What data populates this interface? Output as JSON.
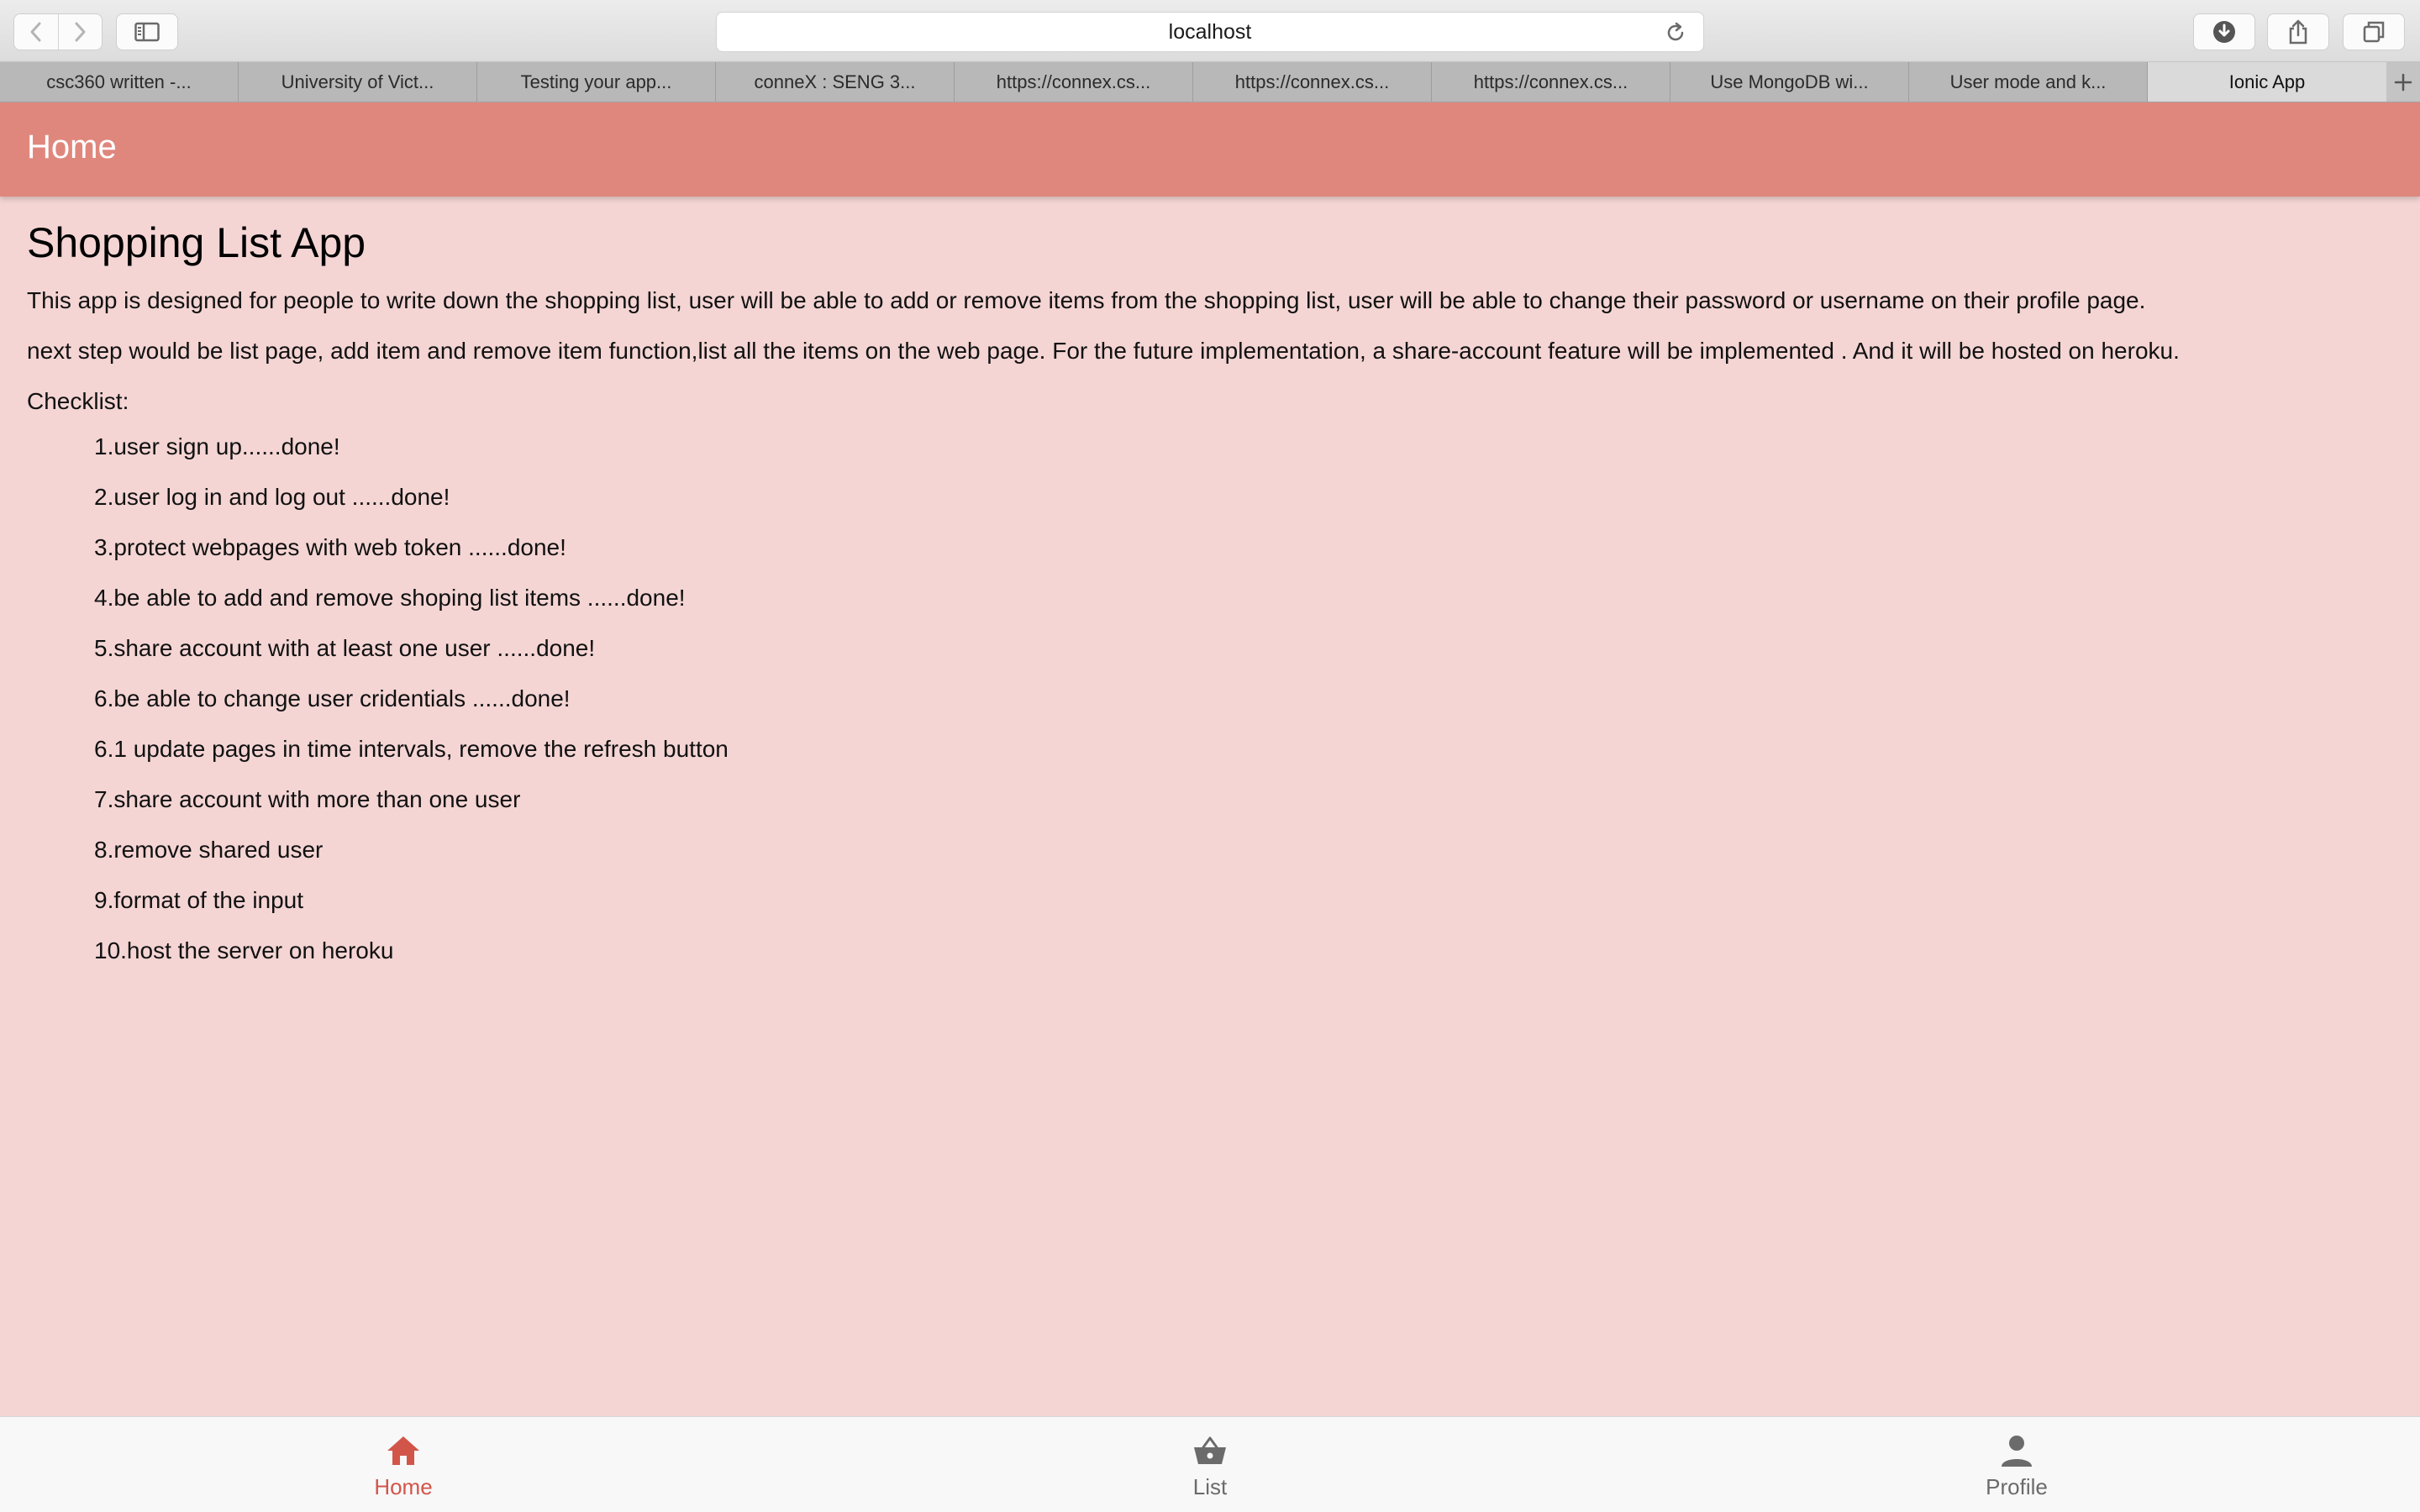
{
  "browser": {
    "url": "localhost",
    "tabs": [
      {
        "label": "csc360 written -..."
      },
      {
        "label": "University of Vict..."
      },
      {
        "label": "Testing your app..."
      },
      {
        "label": "conneX : SENG 3..."
      },
      {
        "label": "https://connex.cs..."
      },
      {
        "label": "https://connex.cs..."
      },
      {
        "label": "https://connex.cs..."
      },
      {
        "label": "Use MongoDB wi..."
      },
      {
        "label": "User mode and k..."
      },
      {
        "label": "Ionic App"
      }
    ],
    "active_tab_index": 9
  },
  "header": {
    "title": "Home"
  },
  "main": {
    "title": "Shopping List App",
    "paragraphs": [
      "This app is designed for people to write down the shopping list, user will be able to add or remove items from the shopping list, user will be able to change their password or username on their profile page.",
      "next step would be list page, add item and remove item function,list all the items on the web page. For the future implementation, a share-account feature will be implemented . And it will be hosted on heroku.",
      "Checklist:"
    ],
    "checklist": [
      "1.user sign up......done!",
      "2.user log in and log out ......done!",
      "3.protect webpages with web token ......done!",
      "4.be able to add and remove shoping list items ......done!",
      "5.share account with at least one user ......done!",
      "6.be able to change user cridentials ......done!",
      "6.1 update pages in time intervals, remove the refresh button",
      "7.share account with more than one user",
      "8.remove shared user",
      "9.format of the input",
      "10.host the server on heroku"
    ]
  },
  "tabbar": {
    "items": [
      {
        "label": "Home",
        "icon": "home-icon",
        "selected": true
      },
      {
        "label": "List",
        "icon": "basket-icon",
        "selected": false
      },
      {
        "label": "Profile",
        "icon": "person-icon",
        "selected": false
      }
    ]
  },
  "colors": {
    "header_bg": "#e0877d",
    "content_bg": "#f4d5d4",
    "accent": "#d2554a",
    "tab_inactive": "#6b6b6b"
  }
}
